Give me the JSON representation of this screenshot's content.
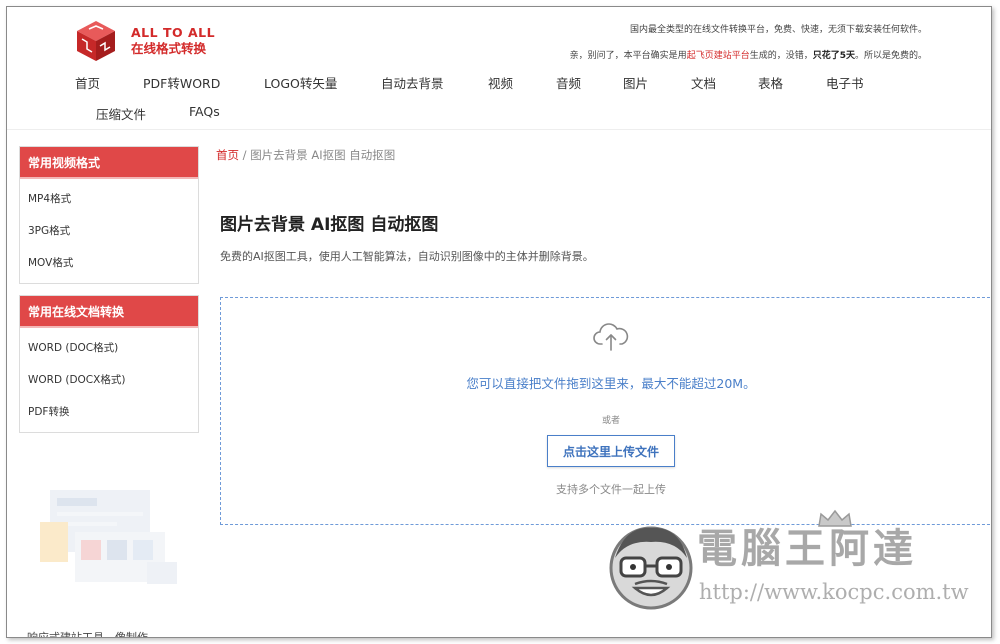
{
  "header": {
    "logo_line1": "ALL TO ALL",
    "logo_line2": "在线格式转换",
    "notice1": "国内最全类型的在线文件转换平台，免费、快速，无须下载安装任何软件。",
    "notice2_prefix": "亲，别问了，本平台确实是用",
    "notice2_highlight": "起飞页建站平台",
    "notice2_middle": "生成的，没错，",
    "notice2_bold": "只花了5天",
    "notice2_suffix": "。所以是免费的。"
  },
  "nav": {
    "items": [
      "首页",
      "PDF转WORD",
      "LOGO转矢量",
      "自动去背景",
      "视频",
      "音频",
      "图片",
      "文档",
      "表格",
      "电子书",
      "压缩文件",
      "FAQs"
    ]
  },
  "sidebar": {
    "video_title": "常用视频格式",
    "video_items": [
      "MP4格式",
      "3PG格式",
      "MOV格式"
    ],
    "doc_title": "常用在线文档转换",
    "doc_items": [
      "WORD (DOC格式)",
      "WORD (DOCX格式)",
      "PDF转换"
    ],
    "bottom_text": "响应式建站工具，像制作"
  },
  "breadcrumb": {
    "home": "首页",
    "separator": " / ",
    "current": "图片去背景 AI抠图 自动抠图"
  },
  "main": {
    "title": "图片去背景 AI抠图 自动抠图",
    "description": "免费的AI抠图工具，使用人工智能算法，自动识别图像中的主体并删除背景。"
  },
  "upload": {
    "drop_text": "您可以直接把文件拖到这里来，最大不能超过20M。",
    "or_text": "或者",
    "button_label": "点击这里上传文件",
    "multi_text": "支持多个文件一起上传"
  },
  "watermark": {
    "title": "電腦王阿達",
    "url": "http://www.kocpc.com.tw"
  },
  "colors": {
    "brand_red": "#d32a2a",
    "sidebar_red": "#e04848",
    "link_blue": "#4a7fc9"
  }
}
